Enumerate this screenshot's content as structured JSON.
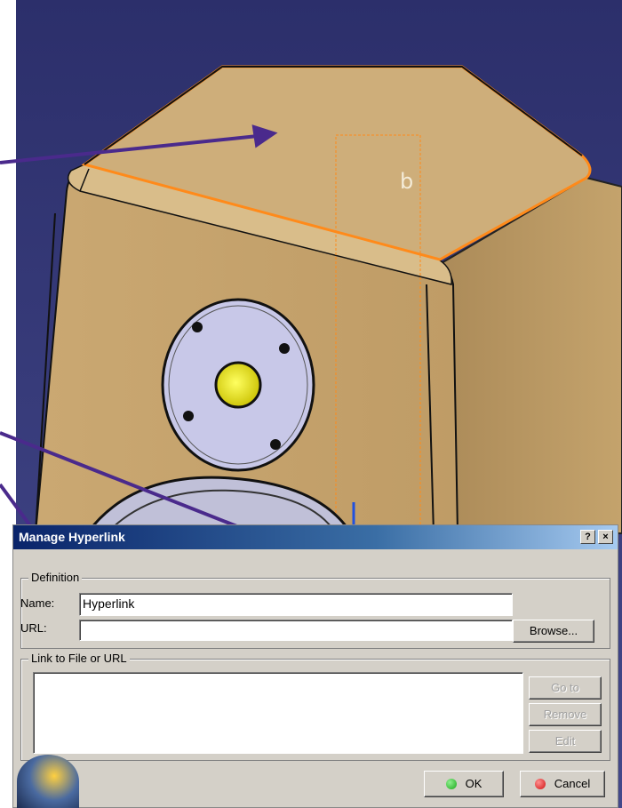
{
  "dialog": {
    "title": "Manage Hyperlink",
    "help_label": "?",
    "close_label": "×",
    "definition": {
      "legend": "Definition",
      "name_label": "Name:",
      "name_value": "Hyperlink",
      "url_label": "URL:",
      "url_value": "",
      "browse_label": "Browse..."
    },
    "links": {
      "legend": "Link to File or URL",
      "goto_label": "Go to",
      "remove_label": "Remove",
      "edit_label": "Edit"
    },
    "ok_label": "OK",
    "cancel_label": "Cancel"
  },
  "colors": {
    "background": "#2e3168",
    "model_face": "#c8a772",
    "highlight": "#ff8a1a",
    "arrow": "#4a2a8c",
    "ok_icon": "#1aa81a",
    "cancel_icon": "#d01010"
  }
}
